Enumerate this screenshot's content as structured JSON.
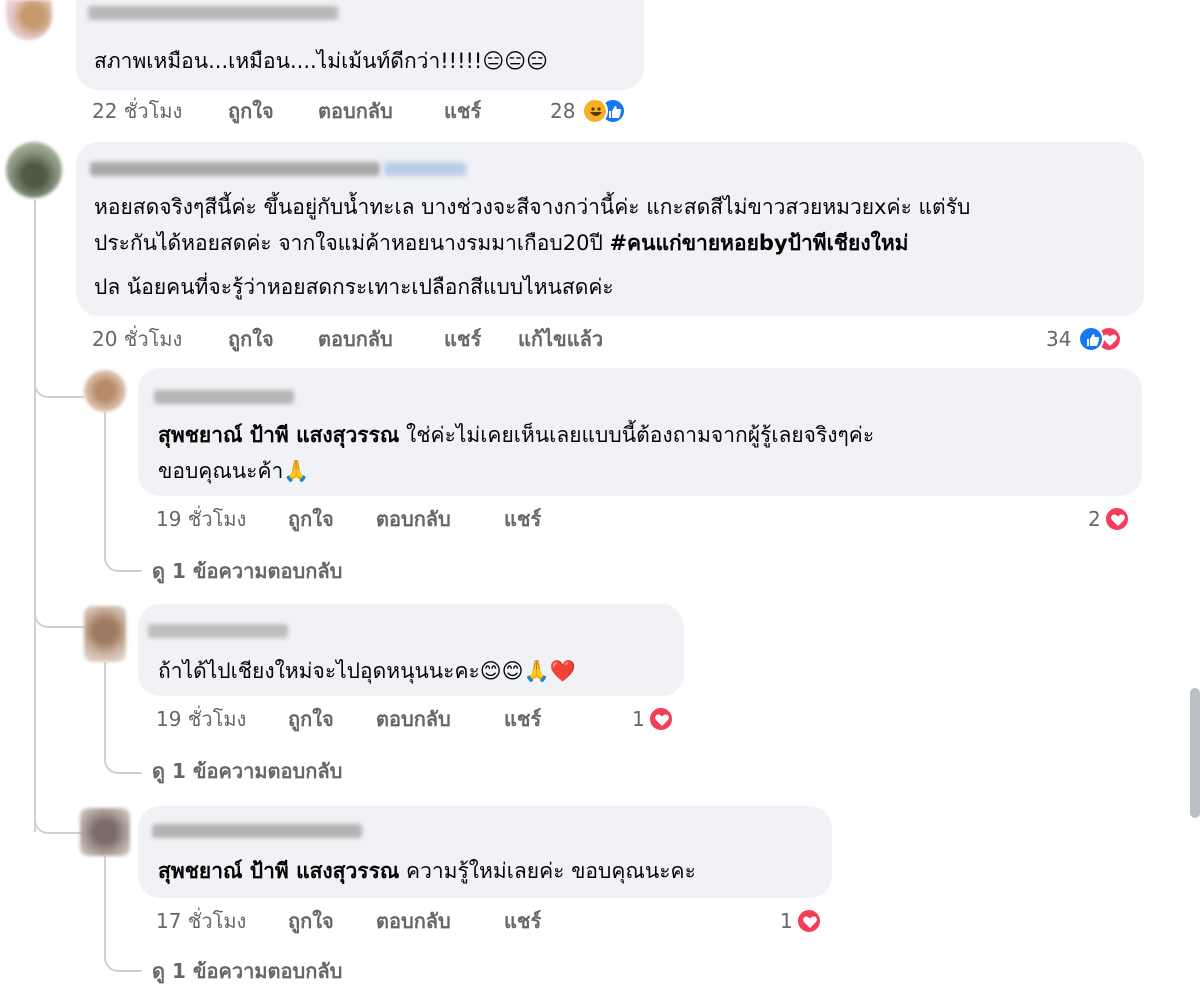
{
  "comments": [
    {
      "text": "สภาพเหมือน...เหมือน....ไม่เม้นท์ดีกว่า!!!!!😑😑😑",
      "time": "22 ชั่วโมง",
      "like": "ถูกใจ",
      "reply": "ตอบกลับ",
      "share": "แชร์",
      "reaction_count": "28",
      "reactions": [
        "haha-icon",
        "like-icon"
      ]
    },
    {
      "lines": [
        "หอยสดจริงๆสีนี้ค่ะ ขึ้นอยู่กับน้ำทะเล บางช่วงจะสีจางกว่านี้ค่ะ แกะสดสีไม่ขาวสวยหมวยxค่ะ แต่รับ",
        "ประกันได้หอยสดค่ะ จากใจแม่ค้าหอยนางรมมาเกือบ20ปี "
      ],
      "hashtag": "#คนแก่ขายหอยbyป้าพีเชียงใหม่",
      "line3": "ปล น้อยคนที่จะรู้ว่าหอยสดกระเทาะเปลือกสีแบบไหนสดค่ะ",
      "time": "20 ชั่วโมง",
      "like": "ถูกใจ",
      "reply": "ตอบกลับ",
      "share": "แชร์",
      "edited": "แก้ไขแล้ว",
      "reaction_count": "34",
      "reactions": [
        "like-icon",
        "love-icon"
      ],
      "replies": [
        {
          "mention": "สุพชยาณ์ ป้าพี แสงสุวรรณ",
          "text": " ใช่ค่ะไม่เคยเห็นเลยแบบนี้ต้องถามจากผู้รู้เลยจริงๆค่ะ",
          "line2": "ขอบคุณนะค้า🙏",
          "time": "19 ชั่วโมง",
          "like": "ถูกใจ",
          "reply": "ตอบกลับ",
          "share": "แชร์",
          "reaction_count": "2",
          "view_replies": "ดู 1 ข้อความตอบกลับ"
        },
        {
          "text": "ถ้าได้ไปเชียงใหม่จะไปอุดหนุนนะคะ😊😊🙏❤️",
          "time": "19 ชั่วโมง",
          "like": "ถูกใจ",
          "reply": "ตอบกลับ",
          "share": "แชร์",
          "reaction_count": "1",
          "view_replies": "ดู 1 ข้อความตอบกลับ"
        },
        {
          "mention": "สุพชยาณ์ ป้าพี แสงสุวรรณ",
          "text": " ความรู้ใหม่เลยค่ะ ขอบคุณนะคะ",
          "time": "17 ชั่วโมง",
          "like": "ถูกใจ",
          "reply": "ตอบกลับ",
          "share": "แชร์",
          "reaction_count": "1",
          "view_replies": "ดู 1 ข้อความตอบกลับ"
        }
      ]
    }
  ],
  "colors": {
    "bubble": "#f0f2f5",
    "meta": "#65676b",
    "like": "#1877f2",
    "love": "#f33e58"
  }
}
